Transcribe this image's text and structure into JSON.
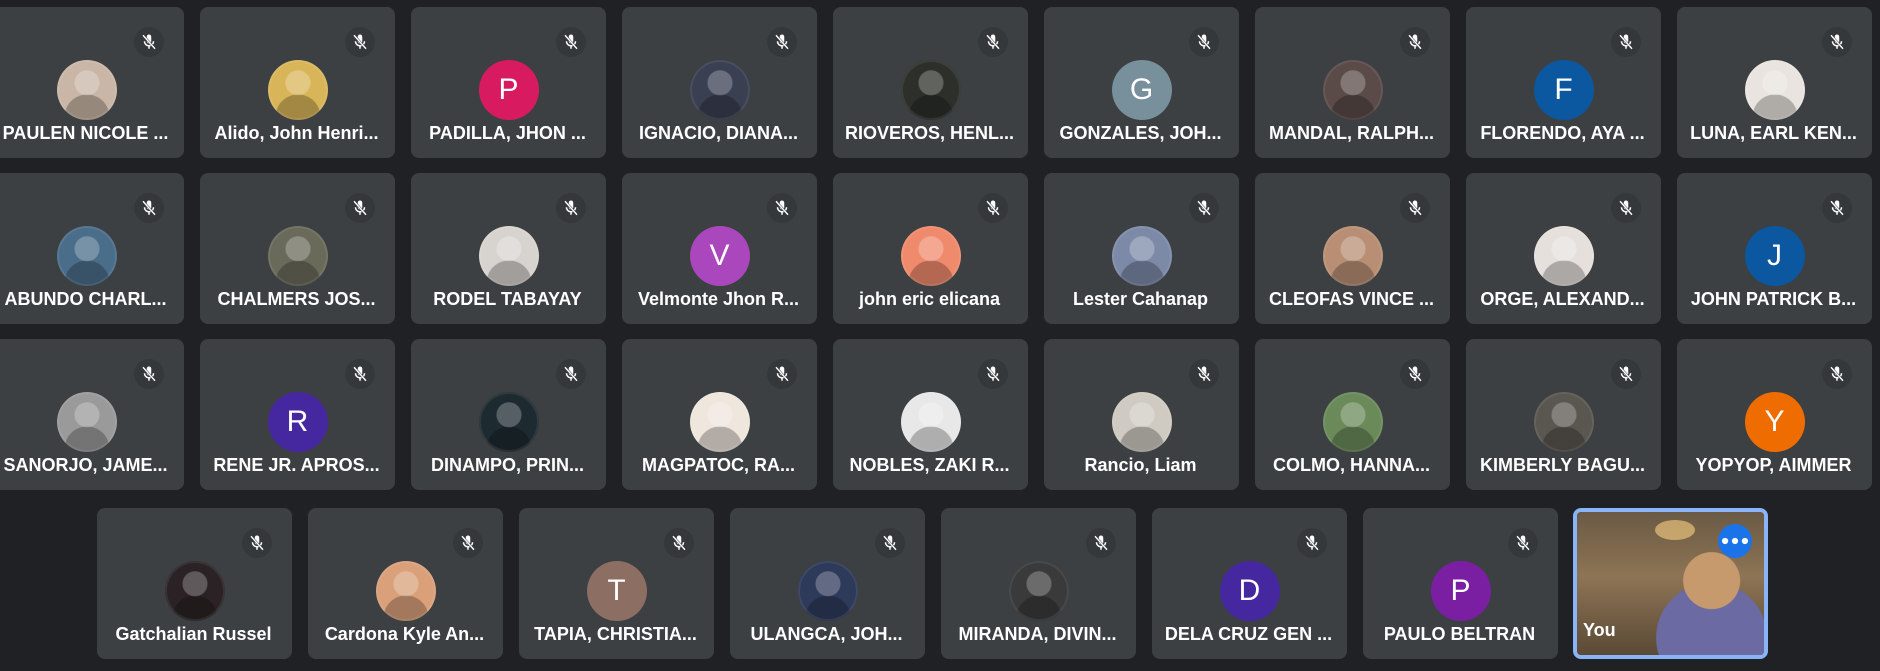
{
  "colors": {
    "background": "#202124",
    "tile": "#3c4043",
    "self_border": "#8ab4f8",
    "more_button": "#1a73e8"
  },
  "participants": [
    {
      "name": "PAULEN NICOLE ...",
      "avatar": "photo",
      "color": "#c9b6a6",
      "muted": true
    },
    {
      "name": "Alido, John Henri...",
      "avatar": "photo",
      "color": "#d9b55a",
      "muted": true
    },
    {
      "name": "PADILLA, JHON ...",
      "avatar": "letter",
      "initial": "P",
      "color": "#d81b60",
      "muted": true
    },
    {
      "name": "IGNACIO, DIANA...",
      "avatar": "photo",
      "color": "#3a3f52",
      "muted": true
    },
    {
      "name": "RIOVEROS, HENL...",
      "avatar": "photo",
      "color": "#2c2f2a",
      "muted": true
    },
    {
      "name": "GONZALES, JOH...",
      "avatar": "letter",
      "initial": "G",
      "color": "#78909c",
      "muted": true
    },
    {
      "name": "MANDAL, RALPH...",
      "avatar": "photo",
      "color": "#5a4a48",
      "muted": true
    },
    {
      "name": "FLORENDO, AYA ...",
      "avatar": "letter",
      "initial": "F",
      "color": "#0b57a0",
      "muted": true
    },
    {
      "name": "LUNA, EARL KEN...",
      "avatar": "photo",
      "color": "#e9e4df",
      "muted": true
    },
    {
      "name": "ABUNDO CHARL...",
      "avatar": "photo",
      "color": "#4a6d8a",
      "muted": true
    },
    {
      "name": "CHALMERS JOS...",
      "avatar": "photo",
      "color": "#6a6a5a",
      "muted": true
    },
    {
      "name": "RODEL TABAYAY",
      "avatar": "photo",
      "color": "#d7d3cf",
      "muted": true
    },
    {
      "name": "Velmonte Jhon R...",
      "avatar": "letter",
      "initial": "V",
      "color": "#ab47bc",
      "muted": true
    },
    {
      "name": "john eric elicana",
      "avatar": "photo",
      "color": "#f08a6c",
      "muted": true
    },
    {
      "name": "Lester Cahanap",
      "avatar": "photo",
      "color": "#7c8aa8",
      "muted": true
    },
    {
      "name": "CLEOFAS VINCE ...",
      "avatar": "photo",
      "color": "#b88f74",
      "muted": true
    },
    {
      "name": "ORGE, ALEXAND...",
      "avatar": "photo",
      "color": "#e6e0dc",
      "muted": true
    },
    {
      "name": "JOHN PATRICK B...",
      "avatar": "letter",
      "initial": "J",
      "color": "#0b57a0",
      "muted": true
    },
    {
      "name": "SANORJO, JAME...",
      "avatar": "photo",
      "color": "#9a9a9a",
      "muted": true
    },
    {
      "name": "RENE JR. APROS...",
      "avatar": "letter",
      "initial": "R",
      "color": "#4527a0",
      "muted": true
    },
    {
      "name": "DINAMPO, PRIN...",
      "avatar": "photo",
      "color": "#1d2a30",
      "muted": true
    },
    {
      "name": "MAGPATOC, RA...",
      "avatar": "photo",
      "color": "#efe6dd",
      "muted": true
    },
    {
      "name": "NOBLES, ZAKI R...",
      "avatar": "photo",
      "color": "#e8e8e8",
      "muted": true
    },
    {
      "name": "Rancio, Liam",
      "avatar": "photo",
      "color": "#cfcac2",
      "muted": true
    },
    {
      "name": "COLMO, HANNA...",
      "avatar": "photo",
      "color": "#6a8a5a",
      "muted": true
    },
    {
      "name": "KIMBERLY BAGU...",
      "avatar": "photo",
      "color": "#5a5650",
      "muted": true
    },
    {
      "name": "YOPYOP, AIMMER",
      "avatar": "letter",
      "initial": "Y",
      "color": "#ef6c00",
      "muted": true
    },
    {
      "name": "Gatchalian Russel",
      "avatar": "photo",
      "color": "#2a2224",
      "muted": true
    },
    {
      "name": "Cardona Kyle An...",
      "avatar": "photo",
      "color": "#d9a07a",
      "muted": true
    },
    {
      "name": "TAPIA, CHRISTIA...",
      "avatar": "letter",
      "initial": "T",
      "color": "#8d6e63",
      "muted": true
    },
    {
      "name": "ULANGCA, JOH...",
      "avatar": "photo",
      "color": "#2d3a5a",
      "muted": true
    },
    {
      "name": "MIRANDA, DIVIN...",
      "avatar": "photo",
      "color": "#3a3a3a",
      "muted": true
    },
    {
      "name": "DELA CRUZ GEN ...",
      "avatar": "letter",
      "initial": "D",
      "color": "#4527a0",
      "muted": true
    },
    {
      "name": "PAULO BELTRAN",
      "avatar": "letter",
      "initial": "P",
      "color": "#7b1fa2",
      "muted": true
    }
  ],
  "self_tile": {
    "name": "You",
    "more_icon": "more-horizontal-icon"
  },
  "icons": {
    "muted": "mic-off-icon"
  }
}
